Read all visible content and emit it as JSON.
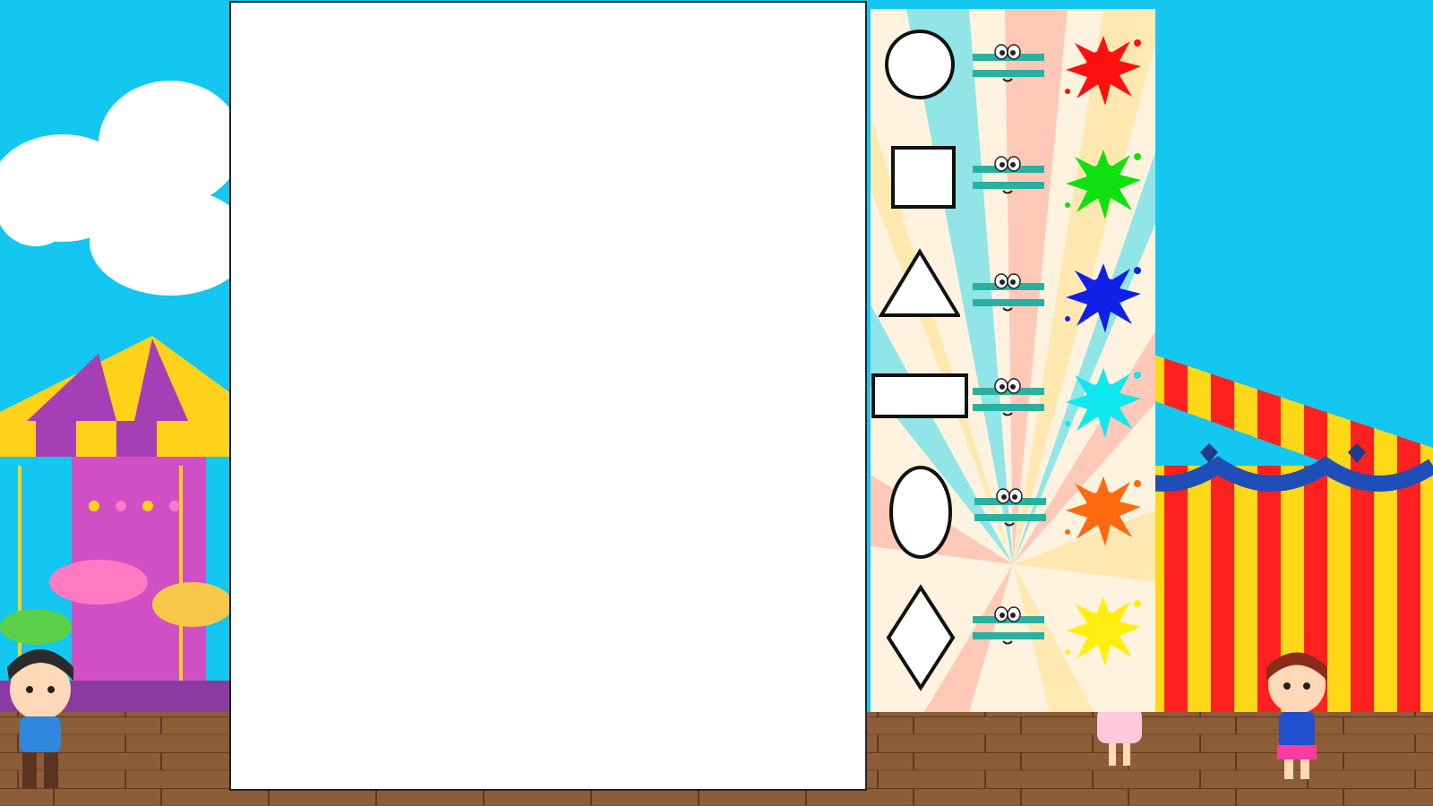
{
  "background": {
    "sky_color": "#13c7f0",
    "floor_color": "#8a5a36",
    "cloud_color": "#ffffff"
  },
  "legend": {
    "rows": [
      {
        "shape": "circle-icon",
        "color_name": "red",
        "color": "#ff1010"
      },
      {
        "shape": "square-icon",
        "color_name": "green",
        "color": "#10e010"
      },
      {
        "shape": "triangle-icon",
        "color_name": "blue",
        "color": "#1020e8"
      },
      {
        "shape": "rectangle-icon",
        "color_name": "cyan",
        "color": "#10e8f0"
      },
      {
        "shape": "oval-icon",
        "color_name": "orange",
        "color": "#ff6a10"
      },
      {
        "shape": "diamond-icon",
        "color_name": "yellow",
        "color": "#ffee10"
      }
    ]
  }
}
